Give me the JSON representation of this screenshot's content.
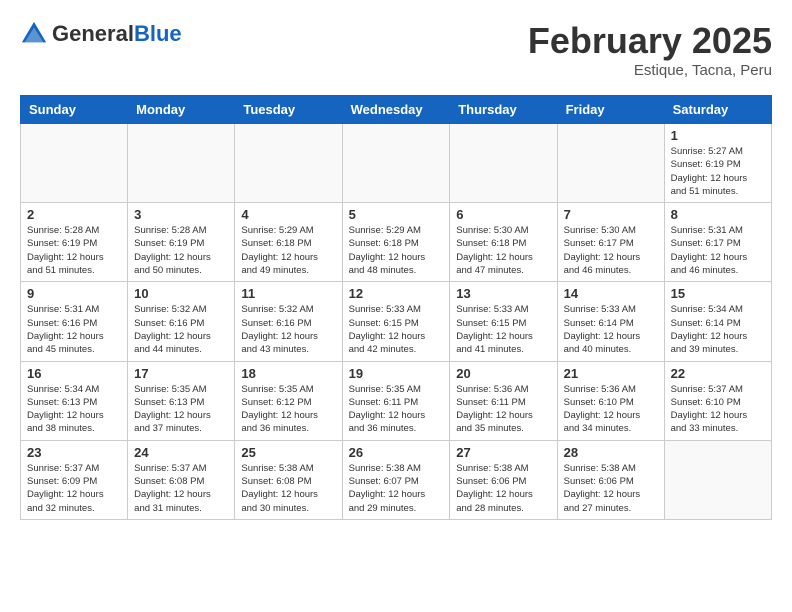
{
  "header": {
    "logo_general": "General",
    "logo_blue": "Blue",
    "month_title": "February 2025",
    "subtitle": "Estique, Tacna, Peru"
  },
  "days_of_week": [
    "Sunday",
    "Monday",
    "Tuesday",
    "Wednesday",
    "Thursday",
    "Friday",
    "Saturday"
  ],
  "weeks": [
    [
      {
        "day": "",
        "info": ""
      },
      {
        "day": "",
        "info": ""
      },
      {
        "day": "",
        "info": ""
      },
      {
        "day": "",
        "info": ""
      },
      {
        "day": "",
        "info": ""
      },
      {
        "day": "",
        "info": ""
      },
      {
        "day": "1",
        "info": "Sunrise: 5:27 AM\nSunset: 6:19 PM\nDaylight: 12 hours\nand 51 minutes."
      }
    ],
    [
      {
        "day": "2",
        "info": "Sunrise: 5:28 AM\nSunset: 6:19 PM\nDaylight: 12 hours\nand 51 minutes."
      },
      {
        "day": "3",
        "info": "Sunrise: 5:28 AM\nSunset: 6:19 PM\nDaylight: 12 hours\nand 50 minutes."
      },
      {
        "day": "4",
        "info": "Sunrise: 5:29 AM\nSunset: 6:18 PM\nDaylight: 12 hours\nand 49 minutes."
      },
      {
        "day": "5",
        "info": "Sunrise: 5:29 AM\nSunset: 6:18 PM\nDaylight: 12 hours\nand 48 minutes."
      },
      {
        "day": "6",
        "info": "Sunrise: 5:30 AM\nSunset: 6:18 PM\nDaylight: 12 hours\nand 47 minutes."
      },
      {
        "day": "7",
        "info": "Sunrise: 5:30 AM\nSunset: 6:17 PM\nDaylight: 12 hours\nand 46 minutes."
      },
      {
        "day": "8",
        "info": "Sunrise: 5:31 AM\nSunset: 6:17 PM\nDaylight: 12 hours\nand 46 minutes."
      }
    ],
    [
      {
        "day": "9",
        "info": "Sunrise: 5:31 AM\nSunset: 6:16 PM\nDaylight: 12 hours\nand 45 minutes."
      },
      {
        "day": "10",
        "info": "Sunrise: 5:32 AM\nSunset: 6:16 PM\nDaylight: 12 hours\nand 44 minutes."
      },
      {
        "day": "11",
        "info": "Sunrise: 5:32 AM\nSunset: 6:16 PM\nDaylight: 12 hours\nand 43 minutes."
      },
      {
        "day": "12",
        "info": "Sunrise: 5:33 AM\nSunset: 6:15 PM\nDaylight: 12 hours\nand 42 minutes."
      },
      {
        "day": "13",
        "info": "Sunrise: 5:33 AM\nSunset: 6:15 PM\nDaylight: 12 hours\nand 41 minutes."
      },
      {
        "day": "14",
        "info": "Sunrise: 5:33 AM\nSunset: 6:14 PM\nDaylight: 12 hours\nand 40 minutes."
      },
      {
        "day": "15",
        "info": "Sunrise: 5:34 AM\nSunset: 6:14 PM\nDaylight: 12 hours\nand 39 minutes."
      }
    ],
    [
      {
        "day": "16",
        "info": "Sunrise: 5:34 AM\nSunset: 6:13 PM\nDaylight: 12 hours\nand 38 minutes."
      },
      {
        "day": "17",
        "info": "Sunrise: 5:35 AM\nSunset: 6:13 PM\nDaylight: 12 hours\nand 37 minutes."
      },
      {
        "day": "18",
        "info": "Sunrise: 5:35 AM\nSunset: 6:12 PM\nDaylight: 12 hours\nand 36 minutes."
      },
      {
        "day": "19",
        "info": "Sunrise: 5:35 AM\nSunset: 6:11 PM\nDaylight: 12 hours\nand 36 minutes."
      },
      {
        "day": "20",
        "info": "Sunrise: 5:36 AM\nSunset: 6:11 PM\nDaylight: 12 hours\nand 35 minutes."
      },
      {
        "day": "21",
        "info": "Sunrise: 5:36 AM\nSunset: 6:10 PM\nDaylight: 12 hours\nand 34 minutes."
      },
      {
        "day": "22",
        "info": "Sunrise: 5:37 AM\nSunset: 6:10 PM\nDaylight: 12 hours\nand 33 minutes."
      }
    ],
    [
      {
        "day": "23",
        "info": "Sunrise: 5:37 AM\nSunset: 6:09 PM\nDaylight: 12 hours\nand 32 minutes."
      },
      {
        "day": "24",
        "info": "Sunrise: 5:37 AM\nSunset: 6:08 PM\nDaylight: 12 hours\nand 31 minutes."
      },
      {
        "day": "25",
        "info": "Sunrise: 5:38 AM\nSunset: 6:08 PM\nDaylight: 12 hours\nand 30 minutes."
      },
      {
        "day": "26",
        "info": "Sunrise: 5:38 AM\nSunset: 6:07 PM\nDaylight: 12 hours\nand 29 minutes."
      },
      {
        "day": "27",
        "info": "Sunrise: 5:38 AM\nSunset: 6:06 PM\nDaylight: 12 hours\nand 28 minutes."
      },
      {
        "day": "28",
        "info": "Sunrise: 5:38 AM\nSunset: 6:06 PM\nDaylight: 12 hours\nand 27 minutes."
      },
      {
        "day": "",
        "info": ""
      }
    ]
  ]
}
